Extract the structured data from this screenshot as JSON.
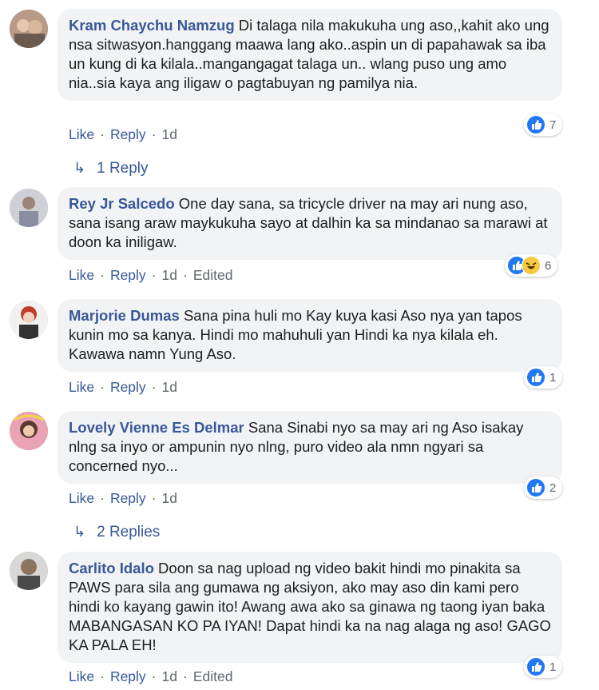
{
  "comments": [
    {
      "author": "Kram Chaychu Namzug",
      "text": "Di talaga nila makukuha ung aso,,kahit ako ung nsa sitwasyon.hanggang maawa lang ako..aspin un di papahawak sa iba un kung di ka kilala..mangangagat talaga un.. wlang puso ung amo nia..sia kaya ang iligaw o pagtabuyan ng pamilya nia.",
      "like": "Like",
      "reply": "Reply",
      "time": "1d",
      "edited": "",
      "reactions": [
        "like"
      ],
      "reaction_count": "7",
      "replies_label": "1 Reply"
    },
    {
      "author": "Rey Jr Salcedo",
      "text": "One day sana, sa tricycle driver na may ari nung aso, sana isang araw maykukuha sayo at dalhin ka sa mindanao sa marawi at doon ka iniligaw.",
      "like": "Like",
      "reply": "Reply",
      "time": "1d",
      "edited": "Edited",
      "reactions": [
        "like",
        "haha"
      ],
      "reaction_count": "6",
      "replies_label": ""
    },
    {
      "author": "Marjorie Dumas",
      "text": "Sana pina huli mo Kay kuya kasi Aso nya yan tapos kunin mo sa kanya. Hindi mo mahuhuli yan Hindi ka nya kilala eh. Kawawa namn Yung Aso.",
      "like": "Like",
      "reply": "Reply",
      "time": "1d",
      "edited": "",
      "reactions": [
        "like"
      ],
      "reaction_count": "1",
      "replies_label": ""
    },
    {
      "author": "Lovely Vienne Es Delmar",
      "text": "Sana Sinabi nyo sa may ari ng Aso isakay nlng sa inyo or ampunin nyo nlng, puro video ala nmn ngyari sa concerned nyo...",
      "like": "Like",
      "reply": "Reply",
      "time": "1d",
      "edited": "",
      "reactions": [
        "like"
      ],
      "reaction_count": "2",
      "replies_label": "2 Replies"
    },
    {
      "author": "Carlito Idalo",
      "text": "Doon sa nag upload ng video bakit hindi mo pinakita sa PAWS para sila ang gumawa ng aksiyon, ako may aso din kami pero hindi ko kayang gawin ito! Awang awa ako sa ginawa ng taong iyan baka MABANGASAN KO PA IYAN! Dapat hindi ka na nag alaga ng aso! GAGO KA PALA EH!",
      "like": "Like",
      "reply": "Reply",
      "time": "1d",
      "edited": "Edited",
      "reactions": [
        "like"
      ],
      "reaction_count": "1",
      "replies_label": ""
    }
  ],
  "colors": {
    "name_link": "#385898",
    "bubble_bg": "#f2f3f5",
    "like_blue": "#2078f4",
    "haha_yellow": "#f7c940",
    "meta_gray": "#606770"
  },
  "icons": {
    "like": "thumbs-up-icon",
    "haha": "haha-face-icon",
    "replies": "reply-arrow-icon"
  }
}
